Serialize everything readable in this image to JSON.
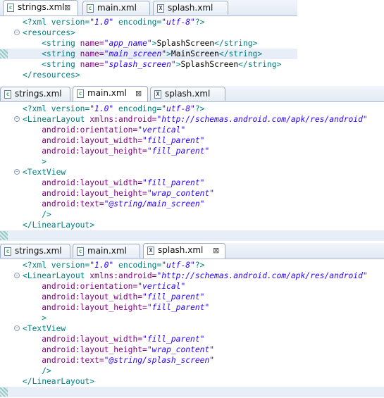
{
  "panels": [
    {
      "id": "strings",
      "tabs": [
        {
          "label": "strings.xml",
          "icon": "xml-file-icon",
          "active": true,
          "close": true
        },
        {
          "label": "main.xml",
          "icon": "xml-file-icon",
          "active": false,
          "close": false
        },
        {
          "label": "splash.xml",
          "icon": "xml-layout-file-icon",
          "active": false,
          "close": false
        }
      ],
      "lines": [
        {
          "fold": false,
          "hl": false,
          "tokens": [
            [
              "pi",
              "<?xml version="
            ],
            [
              "val",
              "\"1.0\""
            ],
            [
              "pi",
              " encoding="
            ],
            [
              "val",
              "\"utf-8\""
            ],
            [
              "pi",
              "?>"
            ]
          ]
        },
        {
          "fold": true,
          "hl": false,
          "tokens": [
            [
              "tag",
              "<resources>"
            ]
          ]
        },
        {
          "fold": false,
          "hl": false,
          "tokens": [
            [
              "txt",
              "    "
            ],
            [
              "tag",
              "<string "
            ],
            [
              "attr",
              "name="
            ],
            [
              "val",
              "\"app_name\""
            ],
            [
              "tag",
              ">"
            ],
            [
              "txt",
              "SplashScreen"
            ],
            [
              "tag",
              "</string>"
            ]
          ]
        },
        {
          "fold": false,
          "hl": true,
          "tokens": [
            [
              "txt",
              "    "
            ],
            [
              "tag",
              "<string "
            ],
            [
              "attr",
              "name="
            ],
            [
              "val",
              "\"main_screen\""
            ],
            [
              "tag",
              ">"
            ],
            [
              "txt",
              "MainScreen"
            ],
            [
              "tag",
              "</string>"
            ]
          ]
        },
        {
          "fold": false,
          "hl": false,
          "tokens": [
            [
              "txt",
              "    "
            ],
            [
              "tag",
              "<string "
            ],
            [
              "attr",
              "name="
            ],
            [
              "val",
              "\"splash_screen\""
            ],
            [
              "tag",
              ">"
            ],
            [
              "txt",
              "SplashScreen"
            ],
            [
              "tag",
              "</string>"
            ]
          ]
        },
        {
          "fold": false,
          "hl": false,
          "tokens": [
            [
              "tag",
              "</resources>"
            ]
          ]
        }
      ]
    },
    {
      "id": "main",
      "tabs": [
        {
          "label": "strings.xml",
          "icon": "xml-file-icon",
          "active": false,
          "close": false
        },
        {
          "label": "main.xml",
          "icon": "xml-file-icon",
          "active": true,
          "close": true
        },
        {
          "label": "splash.xml",
          "icon": "xml-layout-file-icon",
          "active": false,
          "close": false
        }
      ],
      "lines": [
        {
          "fold": false,
          "hl": false,
          "tokens": [
            [
              "pi",
              "<?xml version="
            ],
            [
              "val",
              "\"1.0\""
            ],
            [
              "pi",
              " encoding="
            ],
            [
              "val",
              "\"utf-8\""
            ],
            [
              "pi",
              "?>"
            ]
          ]
        },
        {
          "fold": true,
          "hl": false,
          "tokens": [
            [
              "tag",
              "<LinearLayout "
            ],
            [
              "attr",
              "xmlns:android="
            ],
            [
              "val",
              "\"http://schemas.android.com/apk/res/android\""
            ]
          ]
        },
        {
          "fold": false,
          "hl": false,
          "tokens": [
            [
              "txt",
              "    "
            ],
            [
              "attr",
              "android:orientation="
            ],
            [
              "val",
              "\"vertical\""
            ]
          ]
        },
        {
          "fold": false,
          "hl": false,
          "tokens": [
            [
              "txt",
              "    "
            ],
            [
              "attr",
              "android:layout_width="
            ],
            [
              "val",
              "\"fill_parent\""
            ]
          ]
        },
        {
          "fold": false,
          "hl": false,
          "tokens": [
            [
              "txt",
              "    "
            ],
            [
              "attr",
              "android:layout_height="
            ],
            [
              "val",
              "\"fill_parent\""
            ]
          ]
        },
        {
          "fold": false,
          "hl": false,
          "tokens": [
            [
              "txt",
              "    "
            ],
            [
              "tag",
              ">"
            ]
          ]
        },
        {
          "fold": true,
          "hl": false,
          "tokens": [
            [
              "tag",
              "<TextView"
            ]
          ]
        },
        {
          "fold": false,
          "hl": false,
          "tokens": [
            [
              "txt",
              "    "
            ],
            [
              "attr",
              "android:layout_width="
            ],
            [
              "val",
              "\"fill_parent\""
            ]
          ]
        },
        {
          "fold": false,
          "hl": false,
          "tokens": [
            [
              "txt",
              "    "
            ],
            [
              "attr",
              "android:layout_height="
            ],
            [
              "val",
              "\"wrap_content\""
            ]
          ]
        },
        {
          "fold": false,
          "hl": false,
          "tokens": [
            [
              "txt",
              "    "
            ],
            [
              "attr",
              "android:text="
            ],
            [
              "val",
              "\"@string/main_screen\""
            ]
          ]
        },
        {
          "fold": false,
          "hl": false,
          "tokens": [
            [
              "txt",
              "    "
            ],
            [
              "tag",
              "/>"
            ]
          ]
        },
        {
          "fold": false,
          "hl": false,
          "tokens": [
            [
              "tag",
              "</LinearLayout>"
            ]
          ]
        },
        {
          "fold": false,
          "hl": true,
          "tokens": []
        }
      ]
    },
    {
      "id": "splash",
      "tabs": [
        {
          "label": "strings.xml",
          "icon": "xml-file-icon",
          "active": false,
          "close": false
        },
        {
          "label": "main.xml",
          "icon": "xml-file-icon",
          "active": false,
          "close": false
        },
        {
          "label": "splash.xml",
          "icon": "xml-layout-file-icon",
          "active": true,
          "close": true
        }
      ],
      "lines": [
        {
          "fold": false,
          "hl": false,
          "tokens": [
            [
              "pi",
              "<?xml version="
            ],
            [
              "val",
              "\"1.0\""
            ],
            [
              "pi",
              " encoding="
            ],
            [
              "val",
              "\"utf-8\""
            ],
            [
              "pi",
              "?>"
            ]
          ]
        },
        {
          "fold": true,
          "hl": false,
          "tokens": [
            [
              "tag",
              "<LinearLayout "
            ],
            [
              "attr",
              "xmlns:android="
            ],
            [
              "val",
              "\"http://schemas.android.com/apk/res/android\""
            ]
          ]
        },
        {
          "fold": false,
          "hl": false,
          "tokens": [
            [
              "txt",
              "    "
            ],
            [
              "attr",
              "android:orientation="
            ],
            [
              "val",
              "\"vertical\""
            ]
          ]
        },
        {
          "fold": false,
          "hl": false,
          "tokens": [
            [
              "txt",
              "    "
            ],
            [
              "attr",
              "android:layout_width="
            ],
            [
              "val",
              "\"fill_parent\""
            ]
          ]
        },
        {
          "fold": false,
          "hl": false,
          "tokens": [
            [
              "txt",
              "    "
            ],
            [
              "attr",
              "android:layout_height="
            ],
            [
              "val",
              "\"fill_parent\""
            ]
          ]
        },
        {
          "fold": false,
          "hl": false,
          "tokens": [
            [
              "txt",
              "    "
            ],
            [
              "tag",
              ">"
            ]
          ]
        },
        {
          "fold": true,
          "hl": false,
          "tokens": [
            [
              "tag",
              "<TextView"
            ]
          ]
        },
        {
          "fold": false,
          "hl": false,
          "tokens": [
            [
              "txt",
              "    "
            ],
            [
              "attr",
              "android:layout_width="
            ],
            [
              "val",
              "\"fill_parent\""
            ]
          ]
        },
        {
          "fold": false,
          "hl": false,
          "tokens": [
            [
              "txt",
              "    "
            ],
            [
              "attr",
              "android:layout_height="
            ],
            [
              "val",
              "\"wrap_content\""
            ]
          ]
        },
        {
          "fold": false,
          "hl": false,
          "tokens": [
            [
              "txt",
              "    "
            ],
            [
              "attr",
              "android:text="
            ],
            [
              "val",
              "\"@string/splash_screen\""
            ]
          ]
        },
        {
          "fold": false,
          "hl": false,
          "tokens": [
            [
              "txt",
              "    "
            ],
            [
              "tag",
              "/>"
            ]
          ]
        },
        {
          "fold": false,
          "hl": false,
          "tokens": [
            [
              "tag",
              "</LinearLayout>"
            ]
          ]
        },
        {
          "fold": false,
          "hl": true,
          "tokens": []
        }
      ]
    }
  ],
  "colors": {
    "processing_instruction": "#008080",
    "tag": "#008080",
    "attribute": "#7f007f",
    "value": "#2a00ff",
    "text": "#000000",
    "current_line": "#e8eef8"
  }
}
